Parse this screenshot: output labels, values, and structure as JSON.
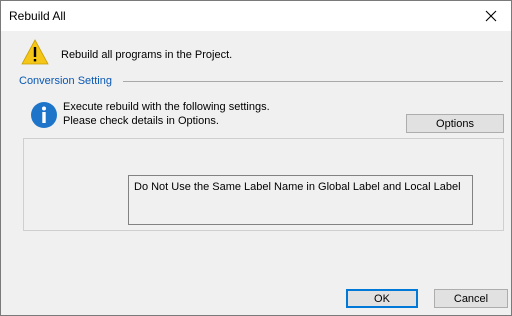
{
  "window": {
    "title": "Rebuild All",
    "close_icon": "close-icon"
  },
  "message": {
    "icon": "warning-icon",
    "text": "Rebuild all programs in the Project."
  },
  "conversion": {
    "group_label": "Conversion Setting",
    "info_icon": "info-icon",
    "info_line1": "Execute rebuild with the following settings.",
    "info_line2": "Please check details in Options.",
    "options_label": "Options",
    "settings": [
      "Do Not Use the Same Label Name in Global Label and Local Label"
    ]
  },
  "footer": {
    "ok_label": "OK",
    "cancel_label": "Cancel"
  },
  "colors": {
    "accent": "#0a58b3",
    "warning": "#f5c518",
    "info": "#1e74c9"
  }
}
